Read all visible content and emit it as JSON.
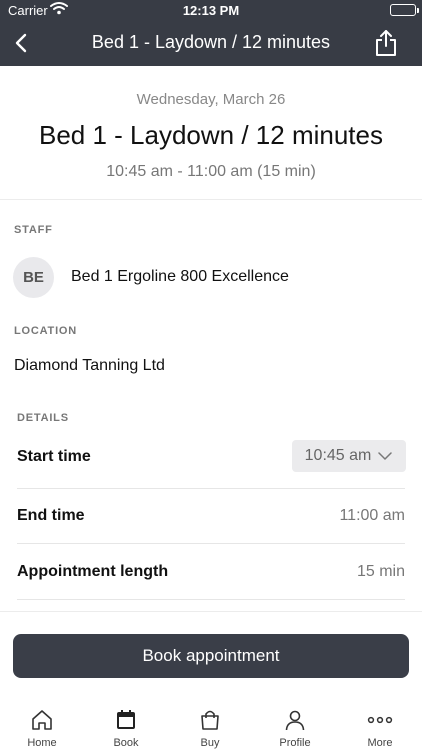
{
  "status_bar": {
    "carrier": "Carrier",
    "time": "12:13 PM"
  },
  "nav": {
    "title": "Bed 1 - Laydown / 12 minutes"
  },
  "header": {
    "date": "Wednesday, March 26",
    "title": "Bed 1 - Laydown / 12 minutes",
    "time_range": "10:45 am - 11:00 am (15 min)"
  },
  "staff": {
    "label": "STAFF",
    "initials": "BE",
    "name": "Bed 1 Ergoline 800 Excellence"
  },
  "location": {
    "label": "LOCATION",
    "name": "Diamond Tanning Ltd"
  },
  "details": {
    "label": "DETAILS",
    "start_time_label": "Start time",
    "start_time_value": "10:45 am",
    "end_time_label": "End time",
    "end_time_value": "11:00 am",
    "length_label": "Appointment length",
    "length_value": "15 min"
  },
  "book_button": "Book appointment",
  "tabs": [
    {
      "label": "Home",
      "icon": "home-icon"
    },
    {
      "label": "Book",
      "icon": "calendar-icon",
      "active": true
    },
    {
      "label": "Buy",
      "icon": "shopping-bag-icon"
    },
    {
      "label": "Profile",
      "icon": "person-icon"
    },
    {
      "label": "More",
      "icon": "more-dots-icon"
    }
  ],
  "colors": {
    "header_bg": "#383c45",
    "button_bg": "#3a3e48"
  }
}
